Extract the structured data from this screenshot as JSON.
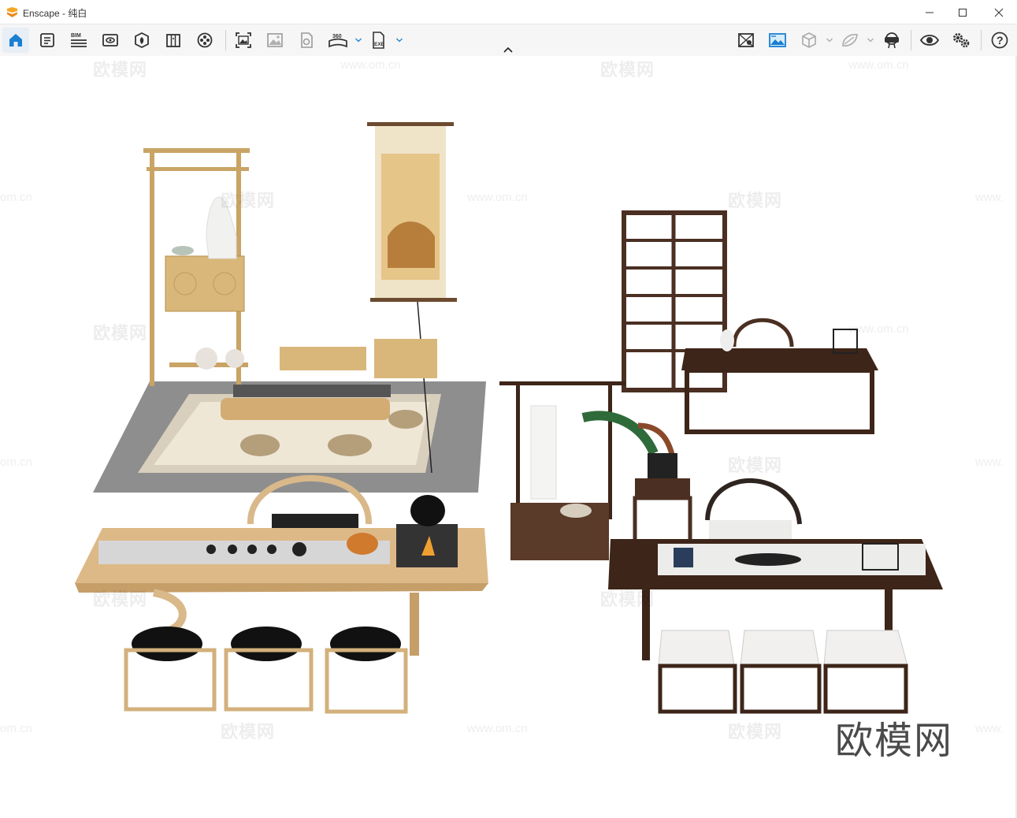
{
  "window": {
    "app_name": "Enscape",
    "title": "Enscape - 纯白",
    "accent_color": "#f5a623",
    "controls": [
      "minimize-icon",
      "maximize-icon",
      "close-icon"
    ]
  },
  "toolbar": {
    "left_tools": [
      "home-icon",
      "document-properties-icon",
      "bim-icon",
      "views-icon",
      "assets-icon",
      "material-editor-icon",
      "video-editor-icon",
      "screenshot-icon",
      "batch-render-icon",
      "export-panorama-icon",
      "360-panorama-icon",
      "export-exe-icon"
    ],
    "bim_label": "BIM",
    "pano_label": "360",
    "exe_label": "EXE",
    "right_tools": [
      "atmosphere-icon",
      "visual-settings-icon",
      "view-cube-icon",
      "material-icon",
      "vr-headset-icon",
      "visibility-icon",
      "settings-icon",
      "help-icon"
    ],
    "help_label": "?"
  },
  "watermark": {
    "brand": "欧模网",
    "url": "www.om.cn",
    "url_cut": "om.cn",
    "url_prefix": "www."
  }
}
